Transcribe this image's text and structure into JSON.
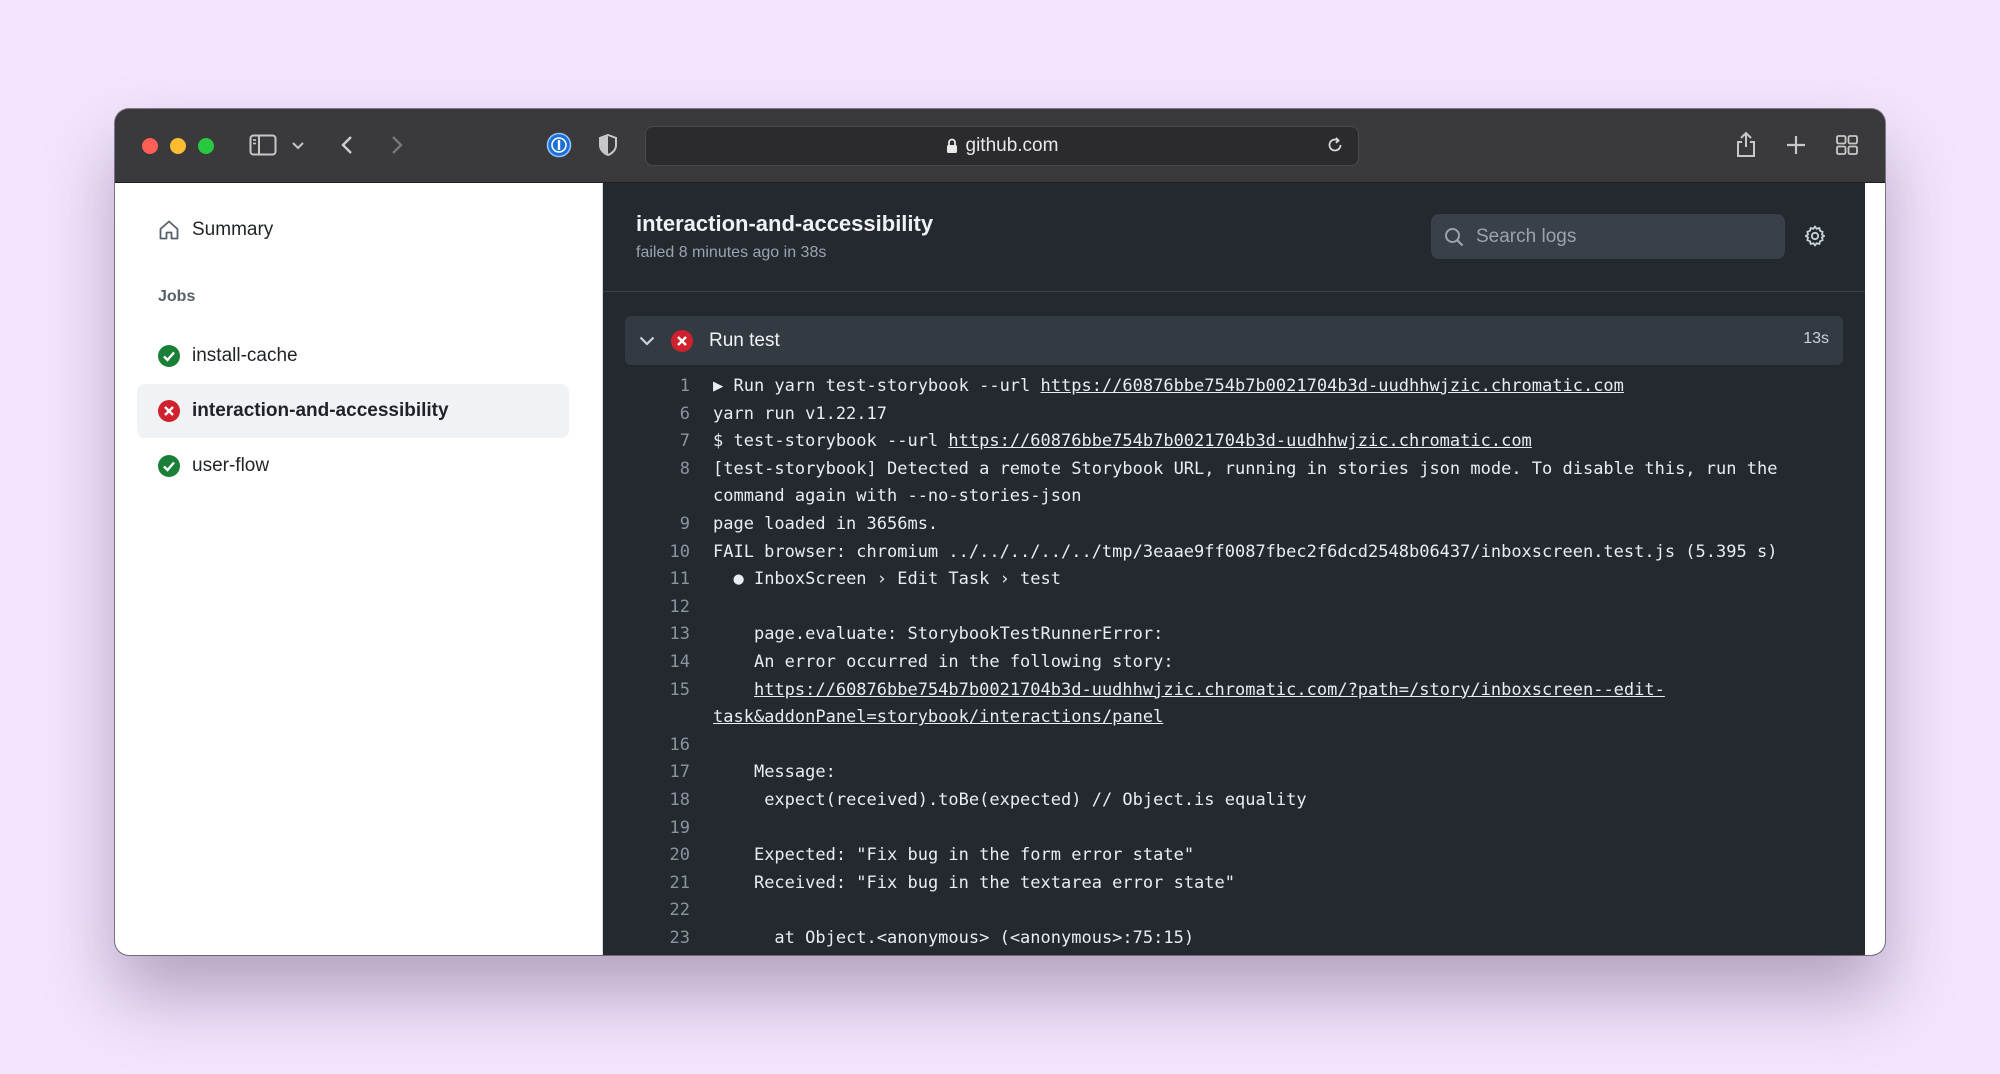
{
  "browser": {
    "url": "github.com",
    "icons": [
      "sidebar-icon",
      "chevron-down-icon",
      "back-icon",
      "forward-icon",
      "password-manager-icon",
      "shield-icon",
      "lock-icon",
      "reload-icon",
      "share-icon",
      "new-tab-icon",
      "tab-overview-icon"
    ]
  },
  "sidebar": {
    "summary_label": "Summary",
    "jobs_heading": "Jobs",
    "jobs": [
      {
        "label": "install-cache",
        "status": "success"
      },
      {
        "label": "interaction-and-accessibility",
        "status": "failure"
      },
      {
        "label": "user-flow",
        "status": "success"
      }
    ]
  },
  "main": {
    "title": "interaction-and-accessibility",
    "meta": "failed 8 minutes ago in 38s",
    "search_placeholder": "Search logs",
    "step": {
      "name": "Run test",
      "duration": "13s",
      "status": "failure"
    }
  },
  "log": [
    {
      "n": "1",
      "text": "▶ Run yarn test-storybook --url ",
      "link": "https://60876bbe754b7b0021704b3d-uudhhwjzic.chromatic.com"
    },
    {
      "n": "6",
      "text": "yarn run v1.22.17"
    },
    {
      "n": "7",
      "text": "$ test-storybook --url ",
      "link": "https://60876bbe754b7b0021704b3d-uudhhwjzic.chromatic.com"
    },
    {
      "n": "8",
      "text": "[test-storybook] Detected a remote Storybook URL, running in stories json mode. To disable this, run the command again with --no-stories-json"
    },
    {
      "n": "9",
      "text": "page loaded in 3656ms."
    },
    {
      "n": "10",
      "text": "FAIL browser: chromium ../../../../../tmp/3eaae9ff0087fbec2f6dcd2548b06437/inboxscreen.test.js (5.395 s)"
    },
    {
      "n": "11",
      "text": "  ● InboxScreen › Edit Task › test"
    },
    {
      "n": "12",
      "text": ""
    },
    {
      "n": "13",
      "text": "    page.evaluate: StorybookTestRunnerError:"
    },
    {
      "n": "14",
      "text": "    An error occurred in the following story:"
    },
    {
      "n": "15",
      "text": "    ",
      "link": "https://60876bbe754b7b0021704b3d-uudhhwjzic.chromatic.com/?path=/story/inboxscreen--edit-task&addonPanel=storybook/interactions/panel"
    },
    {
      "n": "16",
      "text": ""
    },
    {
      "n": "17",
      "text": "    Message:"
    },
    {
      "n": "18",
      "text": "     expect(received).toBe(expected) // Object.is equality"
    },
    {
      "n": "19",
      "text": ""
    },
    {
      "n": "20",
      "text": "    Expected: \"Fix bug in the form error state\""
    },
    {
      "n": "21",
      "text": "    Received: \"Fix bug in the textarea error state\""
    },
    {
      "n": "22",
      "text": ""
    },
    {
      "n": "23",
      "text": "      at Object.<anonymous> (<anonymous>:75:15)"
    }
  ],
  "colors": {
    "success": "#1a7f37",
    "failure": "#cf222e",
    "log_background": "#24292f"
  }
}
